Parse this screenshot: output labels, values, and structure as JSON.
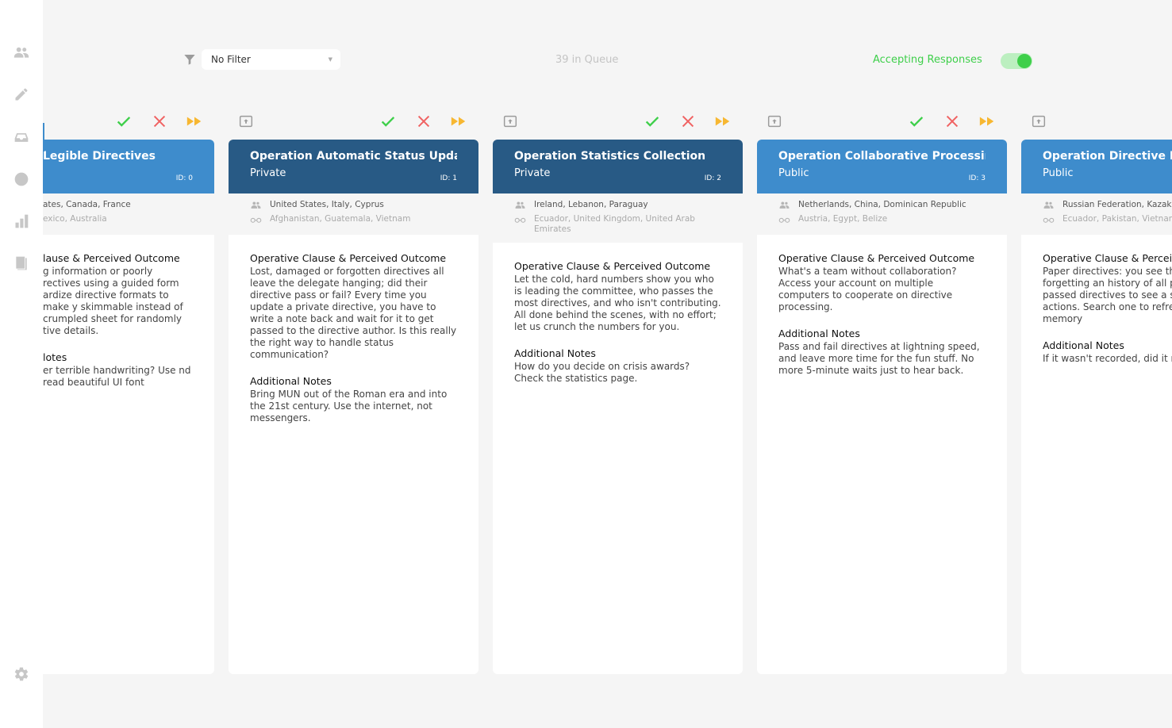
{
  "sidebar": {
    "items": [
      {
        "icon": "users-icon"
      },
      {
        "icon": "pencil-icon"
      },
      {
        "icon": "inbox-icon"
      },
      {
        "icon": "clock-icon"
      },
      {
        "icon": "bar-chart-icon"
      },
      {
        "icon": "book-icon"
      }
    ],
    "settings_icon": "gear-icon"
  },
  "toolbar": {
    "filter_value": "No Filter",
    "queue_text": "39 in Queue",
    "accepting_label": "Accepting Responses",
    "accepting_on": true
  },
  "colors": {
    "header_dark": "#285a85",
    "header_light": "#3e8ccc",
    "accept": "#3ecf4a",
    "reject": "#f06262",
    "skip": "#f7b731"
  },
  "cards": [
    {
      "title": "Legible Directives",
      "privacy": "",
      "id_label": "ID: 0",
      "countries": "ates, Canada, France",
      "observers": "exico, Australia",
      "clause_heading": "lause & Perceived Outcome",
      "clause_text": "g information or poorly rectives using a guided form ardize directive formats to make y skimmable instead of crumpled sheet for randomly tive details.",
      "notes_heading": "lotes",
      "notes_text": "er terrible handwriting? Use nd read beautiful UI font"
    },
    {
      "title": "Operation Automatic Status Updates",
      "privacy": "Private",
      "id_label": "ID: 1",
      "countries": "United States, Italy, Cyprus",
      "observers": "Afghanistan, Guatemala, Vietnam",
      "clause_heading": "Operative Clause & Perceived Outcome",
      "clause_text": "Lost, damaged or forgotten directives all leave the delegate hanging; did their directive pass or fail? Every time you update a private directive, you have to write a note back and wait for it to get passed to the directive author. Is this really the right way to handle status communication?",
      "notes_heading": "Additional Notes",
      "notes_text": "Bring MUN out of the Roman era and into the 21st century. Use the internet, not messengers."
    },
    {
      "title": "Operation Statistics Collection",
      "privacy": "Private",
      "id_label": "ID: 2",
      "countries": "Ireland, Lebanon, Paraguay",
      "observers": "Ecuador, United Kingdom, United Arab Emirates",
      "clause_heading": "Operative Clause & Perceived Outcome",
      "clause_text": "Let the cold, hard numbers show you who is leading the committee, who passes the most directives, and who isn't contributing. All done behind the scenes, with no effort; let us crunch the numbers for you.",
      "notes_heading": "Additional Notes",
      "notes_text": "How do you decide on crisis awards? Check the statistics page."
    },
    {
      "title": "Operation Collaborative Processing",
      "privacy": "Public",
      "id_label": "ID: 3",
      "countries": "Netherlands, China, Dominican Republic",
      "observers": "Austria, Egypt, Belize",
      "clause_heading": "Operative Clause & Perceived Outcome",
      "clause_text": "What's a team without collaboration? Access your account on multiple computers to cooperate on directive processing.",
      "notes_heading": "Additional Notes",
      "notes_text": "Pass and fail directives at lightning speed, and leave more time for the fun stuff. No more 5-minute waits just to hear back."
    },
    {
      "title": "Operation Directive Hist",
      "privacy": "Public",
      "id_label": "",
      "countries": "Russian Federation, Kazakh",
      "observers": "Ecuador, Pakistan, Vietnam",
      "clause_heading": "Operative Clause & Perceiv",
      "clause_text": "Paper directives: you see th them. Skip the forgetting an history of all processed dire passed directives to see a s committee's actions. Search one to refresh your memory",
      "notes_heading": "Additional Notes",
      "notes_text": "If it wasn't recorded, did it r"
    }
  ]
}
